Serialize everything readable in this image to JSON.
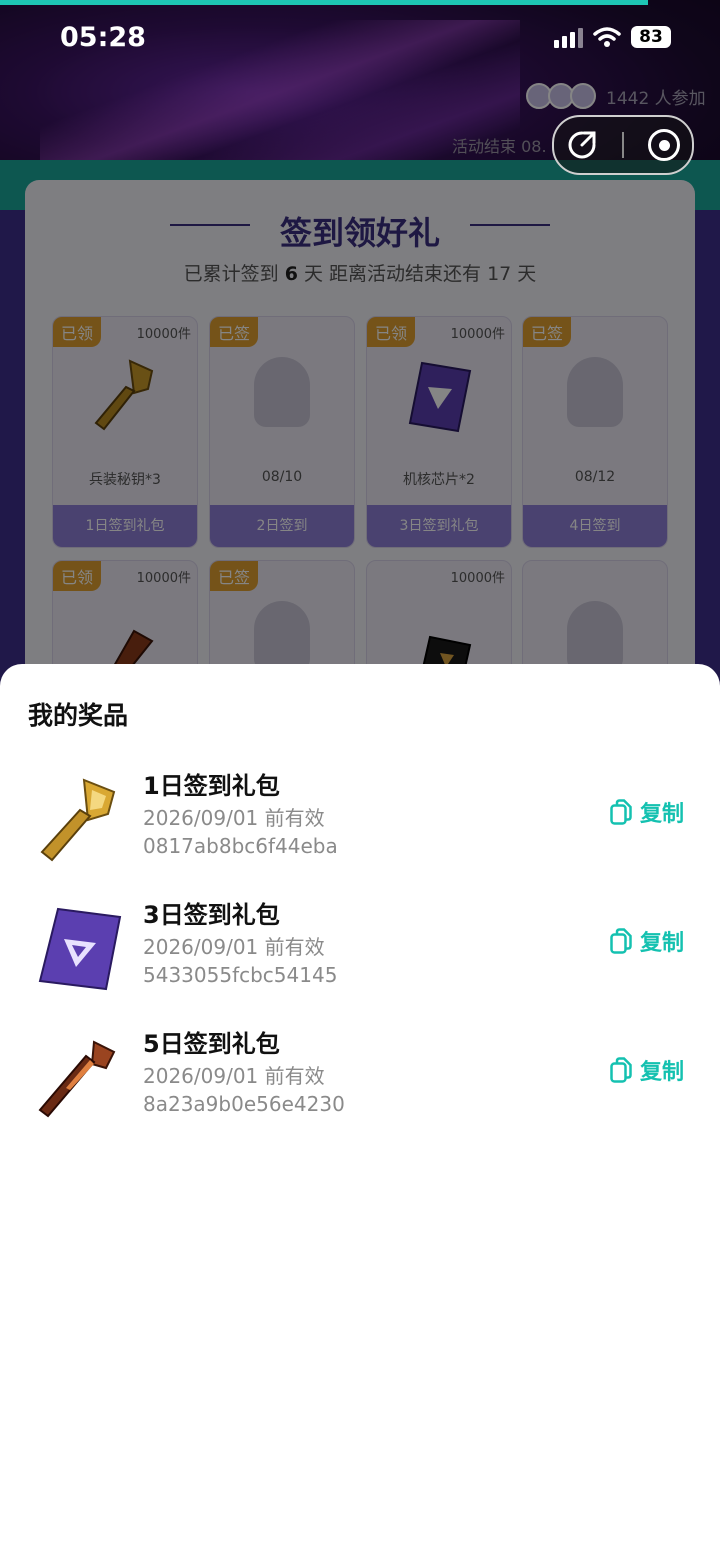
{
  "status_bar": {
    "time": "05:28",
    "battery": "83"
  },
  "header": {
    "participants": "1442 人参加",
    "end_label": "活动结束 08."
  },
  "signin_card": {
    "title": "签到领好礼",
    "subtitle_prefix": "已累计签到",
    "days_signed": "6",
    "subtitle_mid": "天  距离活动结束还有 17 天",
    "tiles_row1": [
      {
        "badge": "已领",
        "count": "10000件",
        "name": "兵装秘钥*3",
        "footer": "1日签到礼包",
        "kind": "key-gold"
      },
      {
        "badge": "已签",
        "count": "",
        "name": "08/10",
        "footer": "2日签到",
        "kind": "ghost"
      },
      {
        "badge": "已领",
        "count": "10000件",
        "name": "机核芯片*2",
        "footer": "3日签到礼包",
        "kind": "chip"
      },
      {
        "badge": "已签",
        "count": "",
        "name": "08/12",
        "footer": "4日签到",
        "kind": "ghost"
      }
    ],
    "tiles_row2": [
      {
        "badge": "已领",
        "count": "10000件",
        "kind": "key-red"
      },
      {
        "badge": "已签",
        "count": "",
        "kind": "ghost"
      },
      {
        "badge": "",
        "count": "10000件",
        "kind": "chip-black"
      },
      {
        "badge": "",
        "count": "",
        "kind": "ghost"
      }
    ]
  },
  "prizes": {
    "title": "我的奖品",
    "copy_label": "复制",
    "items": [
      {
        "name": "1日签到礼包",
        "valid": "2026/09/01 前有效",
        "code": "0817ab8bc6f44eba",
        "icon": "gold-key-icon"
      },
      {
        "name": "3日签到礼包",
        "valid": "2026/09/01 前有效",
        "code": "5433055fcbc54145",
        "icon": "purple-chip-icon"
      },
      {
        "name": "5日签到礼包",
        "valid": "2026/09/01 前有效",
        "code": "8a23a9b0e56e4230",
        "icon": "red-key-icon"
      }
    ]
  },
  "colors": {
    "accent": "#14c1b0",
    "title_purple": "#3b2f80",
    "badge_orange": "#e0a030",
    "tile_footer": "#8e7fd6"
  }
}
